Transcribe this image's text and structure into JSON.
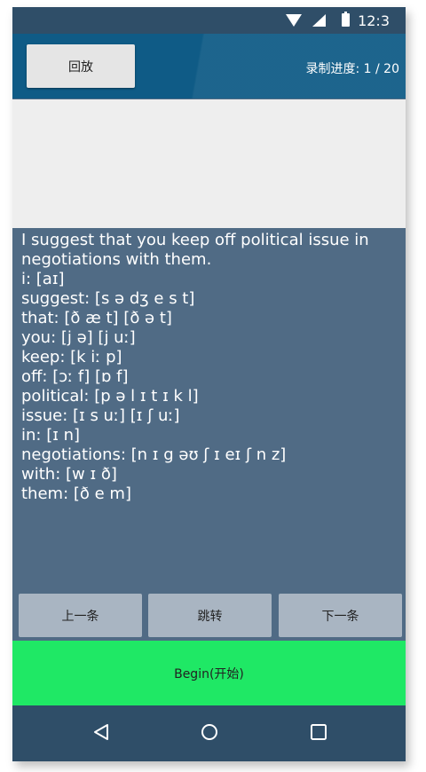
{
  "status": {
    "time": "12:3",
    "icons": [
      "wifi-icon",
      "signal-icon",
      "battery-icon"
    ]
  },
  "toolbar": {
    "replay_label": "回放",
    "progress_text": "录制进度: 1 / 20"
  },
  "content": {
    "sentence": "I suggest that you keep off political issue in negotiations with them.",
    "phonetics": [
      "i: [aɪ]",
      "suggest: [s ə dʒ e s t]",
      "that: [ð æ t] [ð ə t]",
      "you: [j ə] [j uː]",
      "keep: [k iː p]",
      "off: [ɔː f] [ɒ f]",
      "political: [p ə l ɪ t ɪ k l]",
      "issue: [ɪ s uː] [ɪ ʃ uː]",
      "in: [ɪ n]",
      "negotiations: [n ɪ g əʊ ʃ ɪ eɪ ʃ n z]",
      "with: [w ɪ ð]",
      "them: [ð e m]"
    ]
  },
  "nav": {
    "prev_label": "上一条",
    "jump_label": "跳转",
    "next_label": "下一条"
  },
  "begin": {
    "label": "Begin(开始)"
  },
  "system_nav": [
    "back-icon",
    "home-icon",
    "recents-icon"
  ],
  "colors": {
    "appbar": "#0f5b86",
    "content_bg": "#506b85",
    "begin": "#1fe865",
    "nav_button": "#a9b5c2",
    "status_bar": "#2f4e68"
  }
}
